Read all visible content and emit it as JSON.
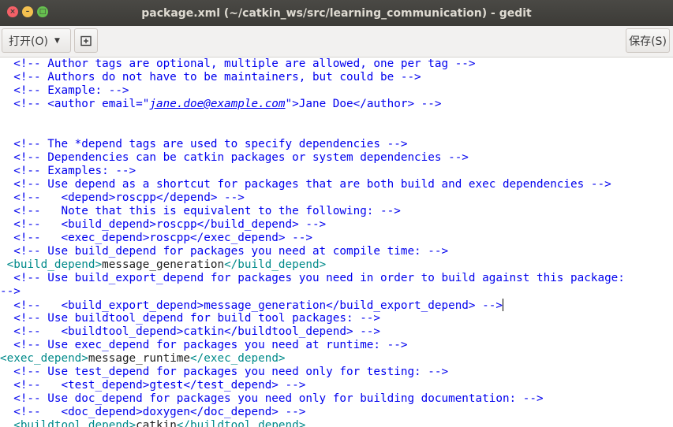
{
  "window": {
    "title": "package.xml (~/catkin_ws/src/learning_communication) - gedit",
    "close_glyph": "×",
    "minimize_glyph": "–",
    "maximize_glyph": "□"
  },
  "toolbar": {
    "open_label": "打开(O)",
    "new_tab_icon": "new-tab-icon",
    "save_label": "保存(S)"
  },
  "editor": {
    "lines": [
      {
        "segments": [
          {
            "text": "  <!-- Author tags are optional, multiple are allowed, one per tag -->",
            "cls": "c"
          }
        ]
      },
      {
        "segments": [
          {
            "text": "  <!-- Authors do not have to be maintainers, but could be -->",
            "cls": "c"
          }
        ]
      },
      {
        "segments": [
          {
            "text": "  <!-- Example: -->",
            "cls": "c"
          }
        ]
      },
      {
        "segments": [
          {
            "text": "  <!-- <author email=\"",
            "cls": "c"
          },
          {
            "text": "jane.doe@example.com",
            "cls": "c u"
          },
          {
            "text": "\">Jane Doe</author> -->",
            "cls": "c"
          }
        ]
      },
      {
        "segments": [
          {
            "text": "",
            "cls": "c"
          }
        ]
      },
      {
        "segments": [
          {
            "text": "",
            "cls": "c"
          }
        ]
      },
      {
        "segments": [
          {
            "text": "  <!-- The *depend tags are used to specify dependencies -->",
            "cls": "c"
          }
        ]
      },
      {
        "segments": [
          {
            "text": "  <!-- Dependencies can be catkin packages or system dependencies -->",
            "cls": "c"
          }
        ]
      },
      {
        "segments": [
          {
            "text": "  <!-- Examples: -->",
            "cls": "c"
          }
        ]
      },
      {
        "segments": [
          {
            "text": "  <!-- Use depend as a shortcut for packages that are both build and exec dependencies -->",
            "cls": "c"
          }
        ]
      },
      {
        "segments": [
          {
            "text": "  <!--   <depend>roscpp</depend> -->",
            "cls": "c"
          }
        ]
      },
      {
        "segments": [
          {
            "text": "  <!--   Note that this is equivalent to the following: -->",
            "cls": "c"
          }
        ]
      },
      {
        "segments": [
          {
            "text": "  <!--   <build_depend>roscpp</build_depend> -->",
            "cls": "c"
          }
        ]
      },
      {
        "segments": [
          {
            "text": "  <!--   <exec_depend>roscpp</exec_depend> -->",
            "cls": "c"
          }
        ]
      },
      {
        "segments": [
          {
            "text": "  <!-- Use build_depend for packages you need at compile time: -->",
            "cls": "c"
          }
        ]
      },
      {
        "segments": [
          {
            "text": " <build_depend>",
            "cls": "t"
          },
          {
            "text": "message_generation",
            "cls": "x"
          },
          {
            "text": "</build_depend>",
            "cls": "t"
          }
        ]
      },
      {
        "segments": [
          {
            "text": "  <!-- Use build_export_depend for packages you need in order to build against this package:",
            "cls": "c"
          }
        ]
      },
      {
        "segments": [
          {
            "text": "-->",
            "cls": "c"
          }
        ]
      },
      {
        "segments": [
          {
            "text": "  <!--   <build_export_depend>message_generation</build_export_depend> -->",
            "cls": "c"
          }
        ],
        "cursor": true
      },
      {
        "segments": [
          {
            "text": "  <!-- Use buildtool_depend for build tool packages: -->",
            "cls": "c"
          }
        ]
      },
      {
        "segments": [
          {
            "text": "  <!--   <buildtool_depend>catkin</buildtool_depend> -->",
            "cls": "c"
          }
        ]
      },
      {
        "segments": [
          {
            "text": "  <!-- Use exec_depend for packages you need at runtime: -->",
            "cls": "c"
          }
        ]
      },
      {
        "segments": [
          {
            "text": "<exec_depend>",
            "cls": "t"
          },
          {
            "text": "message_runtime",
            "cls": "x"
          },
          {
            "text": "</exec_depend>",
            "cls": "t"
          }
        ]
      },
      {
        "segments": [
          {
            "text": "  <!-- Use test_depend for packages you need only for testing: -->",
            "cls": "c"
          }
        ]
      },
      {
        "segments": [
          {
            "text": "  <!--   <test_depend>gtest</test_depend> -->",
            "cls": "c"
          }
        ]
      },
      {
        "segments": [
          {
            "text": "  <!-- Use doc_depend for packages you need only for building documentation: -->",
            "cls": "c"
          }
        ]
      },
      {
        "segments": [
          {
            "text": "  <!--   <doc_depend>doxygen</doc_depend> -->",
            "cls": "c"
          }
        ]
      },
      {
        "segments": [
          {
            "text": "  <buildtool_depend>",
            "cls": "t"
          },
          {
            "text": "catkin",
            "cls": "x"
          },
          {
            "text": "</buildtool_depend>",
            "cls": "t"
          }
        ]
      }
    ]
  },
  "colors": {
    "comment": "#0000ee",
    "tag": "#008a8a",
    "text": "#1d1d1d",
    "titlebar": "#3c3b37"
  }
}
